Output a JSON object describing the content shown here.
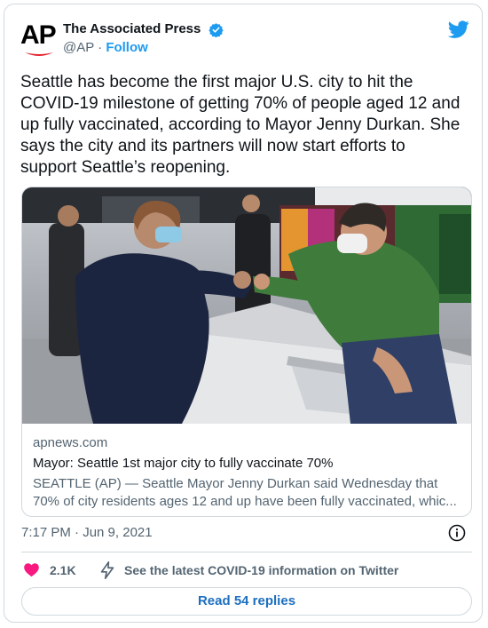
{
  "author": {
    "display_name": "The Associated Press",
    "handle": "@AP",
    "separator": "·",
    "follow_label": "Follow",
    "logo_text": "AP",
    "verified_icon": "verified-badge-icon"
  },
  "tweet": {
    "text": "Seattle has become the first major U.S. city to hit the\nCOVID-19 milestone of getting 70% of people aged 12 and\nup fully vaccinated, according to Mayor Jenny Durkan. She\nsays the city and its partners will now start efforts to\nsupport Seattle’s reopening."
  },
  "link_card": {
    "domain": "apnews.com",
    "title": "Mayor: Seattle 1st major city to fully vaccinate 70%",
    "description_line1": "SEATTLE (AP) — Seattle Mayor Jenny Durkan said Wednesday that",
    "description_line2": "70% of city residents ages 12 and up have been fully vaccinated, whic..."
  },
  "meta": {
    "timestamp": "7:17 PM · Jun 9, 2021"
  },
  "actions": {
    "like_count": "2.1K",
    "latest_info_label": "See the latest COVID-19 information on Twitter"
  },
  "replies": {
    "button_label": "Read 54 replies"
  },
  "colors": {
    "brand_blue": "#1d9bf0",
    "like_pink": "#f91880",
    "text_primary": "#0f1419",
    "text_secondary": "#536471",
    "border": "#cfd9de",
    "ap_red": "#e4202e"
  }
}
